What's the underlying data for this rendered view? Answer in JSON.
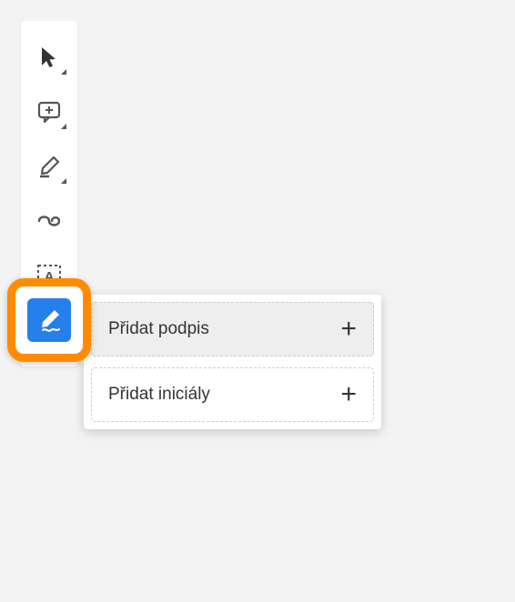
{
  "toolbar": {
    "tools": [
      {
        "name": "select"
      },
      {
        "name": "comment"
      },
      {
        "name": "highlight"
      },
      {
        "name": "draw"
      },
      {
        "name": "text"
      },
      {
        "name": "sign"
      }
    ]
  },
  "popup": {
    "add_signature": "Přidat podpis",
    "add_initials": "Přidat iniciály"
  }
}
